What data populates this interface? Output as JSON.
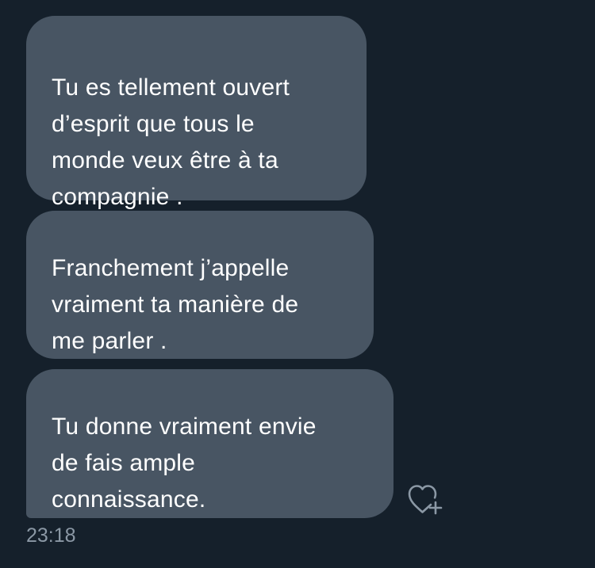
{
  "conversation": {
    "messages": [
      {
        "text": "Tu es tellement ouvert\nd’esprit que tous le\nmonde veux être à ta\ncompagnie ."
      },
      {
        "text": "Franchement j’appelle\nvraiment ta manière de\nme parler ."
      },
      {
        "text": "Tu donne vraiment envie\nde fais ample\nconnaissance."
      }
    ],
    "timestamp": "23:18"
  },
  "colors": {
    "background": "#15202b",
    "bubble": "#485563",
    "text": "#ffffff",
    "muted": "#8b98a5"
  },
  "icons": {
    "reaction": "heart-plus-icon"
  }
}
